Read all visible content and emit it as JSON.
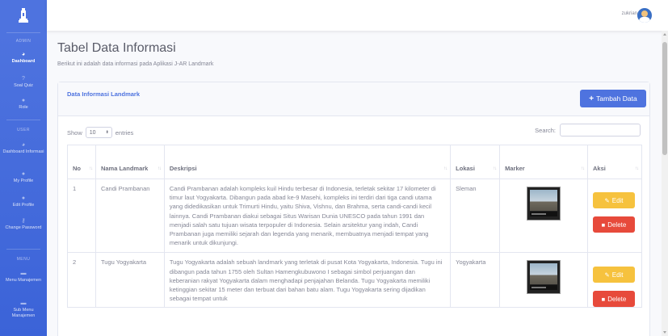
{
  "sidebar": {
    "sections": [
      {
        "heading": "ADMIN"
      },
      {
        "heading": "USER"
      },
      {
        "heading": "MENU"
      }
    ],
    "items": [
      {
        "label": "Dashboard",
        "icon": "tachometer-icon"
      },
      {
        "label": "Soal Quiz",
        "icon": "question-icon"
      },
      {
        "label": "Role",
        "icon": "user-icon"
      },
      {
        "label": "Dashboard Informasi",
        "icon": "tachometer-icon"
      },
      {
        "label": "My Profile",
        "icon": "user-icon"
      },
      {
        "label": "Edit Profile",
        "icon": "user-edit-icon"
      },
      {
        "label": "Change Password",
        "icon": "key-icon"
      },
      {
        "label": "Menu Manajemen",
        "icon": "folder-icon"
      },
      {
        "label": "Sub Menu Manajemen",
        "icon": "folder-open-icon"
      }
    ]
  },
  "topbar": {
    "user_name": "zukrian"
  },
  "page": {
    "title": "Tabel Data Informasi",
    "subtitle": "Berikut ini adalah data informasi pada Aplikasi J-AR Landmark"
  },
  "card": {
    "title": "Data Informasi Landmark",
    "add_button": "Tambah Data"
  },
  "datatable": {
    "show_label": "Show",
    "entries_value": "10",
    "entries_label": "entries",
    "search_label": "Search:",
    "columns": [
      "No",
      "Nama Landmark",
      "Deskripsi",
      "Lokasi",
      "Marker",
      "Aksi"
    ],
    "edit_label": "Edit",
    "delete_label": "Delete",
    "rows": [
      {
        "no": "1",
        "nama": "Candi Prambanan",
        "deskripsi": "Candi Prambanan adalah kompleks kuil Hindu terbesar di Indonesia, terletak sekitar 17 kilometer di timur laut Yogyakarta. Dibangun pada abad ke-9 Masehi, kompleks ini terdiri dari tiga candi utama yang didedikasikan untuk Trimurti Hindu, yaitu Shiva, Vishnu, dan Brahma, serta candi-candi kecil lainnya. Candi Prambanan diakui sebagai Situs Warisan Dunia UNESCO pada tahun 1991 dan menjadi salah satu tujuan wisata terpopuler di Indonesia. Selain arsitektur yang indah, Candi Prambanan juga memiliki sejarah dan legenda yang menarik, membuatnya menjadi tempat yang menarik untuk dikunjungi.",
        "lokasi": "Sleman"
      },
      {
        "no": "2",
        "nama": "Tugu Yogyakarta",
        "deskripsi": "Tugu Yogyakarta adalah sebuah landmark yang terletak di pusat Kota Yogyakarta, Indonesia. Tugu ini dibangun pada tahun 1755 oleh Sultan Hamengkubuwono I sebagai simbol perjuangan dan keberanian rakyat Yogyakarta dalam menghadapi penjajahan Belanda. Tugu Yogyakarta memiliki ketinggian sekitar 15 meter dan terbuat dari bahan batu alam. Tugu Yogyakarta sering dijadikan sebagai tempat untuk",
        "lokasi": "Yogyakarta"
      }
    ]
  },
  "colors": {
    "primary": "#4e73df",
    "warning": "#f6c23e",
    "danger": "#e74a3b",
    "text": "#858796"
  }
}
